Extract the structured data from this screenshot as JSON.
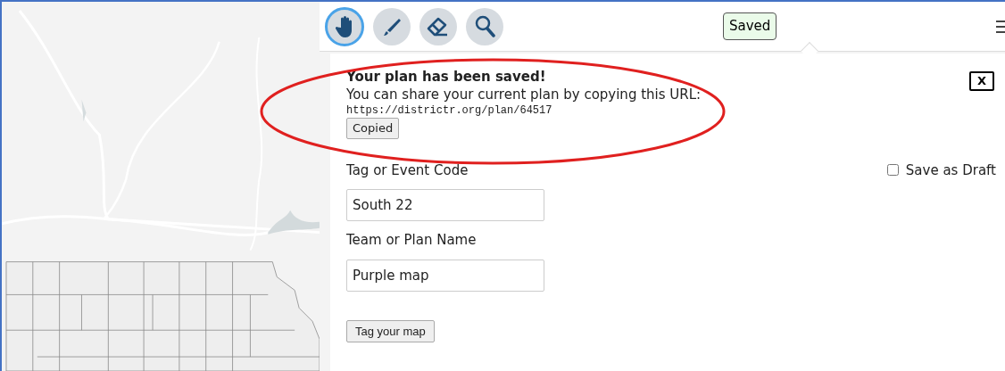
{
  "toolbar": {
    "tools": [
      {
        "kind": "hand",
        "selected": true
      },
      {
        "kind": "brush",
        "selected": false
      },
      {
        "kind": "eraser",
        "selected": false
      },
      {
        "kind": "search",
        "selected": false
      }
    ],
    "status": "Saved"
  },
  "popup": {
    "title": "Your plan has been saved!",
    "message": "You can share your current plan by copying this URL:",
    "url": "https://districtr.org/plan/64517",
    "copy_button": "Copied",
    "close_button": "X",
    "highlighted": true
  },
  "form": {
    "save_as_draft": {
      "label": "Save as Draft",
      "checked": false
    },
    "fields": [
      {
        "label": "Tag or Event Code",
        "value": "South 22"
      },
      {
        "label": "Team or Plan Name",
        "value": "Purple map"
      }
    ],
    "submit": "Tag your map"
  }
}
